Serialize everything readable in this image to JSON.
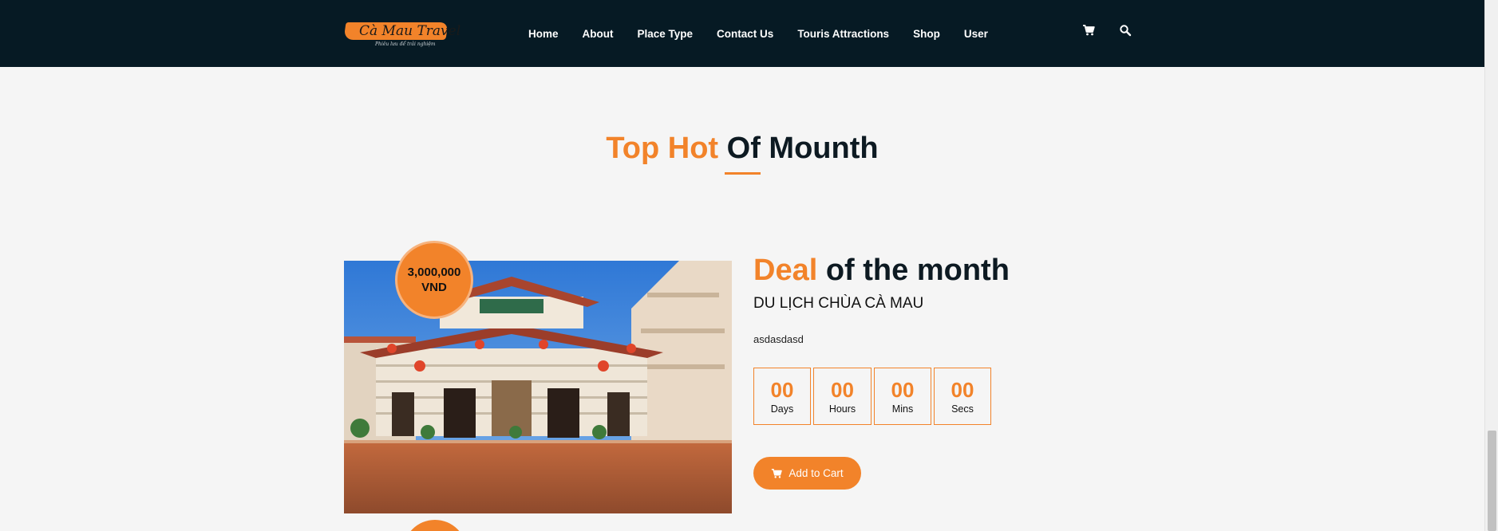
{
  "brand": {
    "logo_text": "Cà Mau Travel",
    "logo_tagline": "Phiêu lưu để trải nghiệm"
  },
  "nav": {
    "items": [
      {
        "label": "Home"
      },
      {
        "label": "About"
      },
      {
        "label": "Place Type"
      },
      {
        "label": "Contact Us"
      },
      {
        "label": "Touris Attractions"
      },
      {
        "label": "Shop"
      },
      {
        "label": "User"
      }
    ],
    "icons": [
      "cart-icon",
      "search-icon"
    ]
  },
  "section": {
    "title_highlight": "Top Hot",
    "title_rest": "Of Mounth"
  },
  "deal": {
    "price_amount": "3,000,000",
    "price_currency": "VND",
    "heading_highlight": "Deal",
    "heading_rest": "of the month",
    "name": "DU LỊCH CHÙA CÀ MAU",
    "description": "asdasdasd",
    "countdown": [
      {
        "value": "00",
        "label": "Days"
      },
      {
        "value": "00",
        "label": "Hours"
      },
      {
        "value": "00",
        "label": "Mins"
      },
      {
        "value": "00",
        "label": "Secs"
      }
    ],
    "cart_button_label": "Add to Cart",
    "image_icon": "pagoda-photo"
  },
  "colors": {
    "accent": "#f2832a",
    "header_bg": "#061a24",
    "page_bg": "#f5f5f5",
    "heading_dark": "#0d1a22"
  }
}
